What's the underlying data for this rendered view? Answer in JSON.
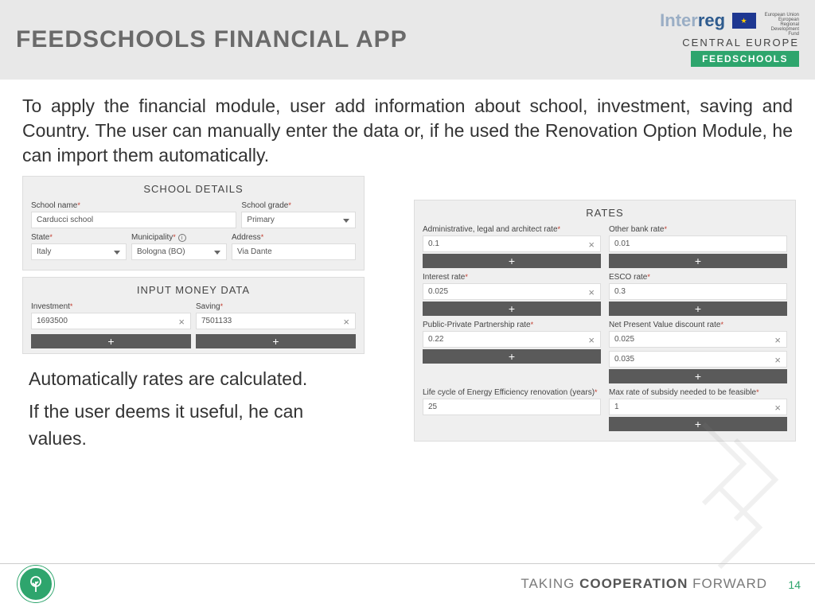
{
  "header": {
    "title": "FEEDSCHOOLS FINANCIAL APP",
    "logo_top": "Interreg",
    "logo_sub": "CENTRAL EUROPE",
    "logo_badge": "FEEDSCHOOLS",
    "eu_text": "European Union European Regional Development Fund"
  },
  "intro": "To apply the financial module, user add information about school, investment, saving and Country. The user can manually enter the data or, if he used the Renovation Option Module, he can import them automatically.",
  "school": {
    "panel_title": "SCHOOL DETAILS",
    "name_lbl": "School name",
    "name_val": "Carducci school",
    "grade_lbl": "School grade",
    "grade_val": "Primary",
    "state_lbl": "State",
    "state_val": "Italy",
    "muni_lbl": "Municipality",
    "muni_val": "Bologna (BO)",
    "addr_lbl": "Address",
    "addr_val": "Via Dante"
  },
  "money": {
    "panel_title": "INPUT MONEY DATA",
    "inv_lbl": "Investment",
    "inv_val": "1693500",
    "sav_lbl": "Saving",
    "sav_val": "7501133"
  },
  "rates": {
    "panel_title": "RATES",
    "admin_lbl": "Administrative, legal and architect rate",
    "admin_val": "0.1",
    "other_lbl": "Other bank rate",
    "other_val": "0.01",
    "int_lbl": "Interest rate",
    "int_val": "0.025",
    "esco_lbl": "ESCO rate",
    "esco_val": "0.3",
    "ppp_lbl": "Public-Private Partnership rate",
    "ppp_val": "0.22",
    "npv_lbl": "Net Present Value discount rate",
    "npv_val1": "0.025",
    "npv_val2": "0.035",
    "life_lbl": "Life cycle of Energy Efficiency renovation (years)",
    "life_val": "25",
    "max_lbl": "Max rate of subsidy needed to be feasible",
    "max_val": "1"
  },
  "body1": "Automatically rates are calculated.",
  "body2": "If the user deems it useful, he can",
  "body3": "values.",
  "footer": {
    "text_a": "TAKING ",
    "text_b": "COOPERATION",
    "text_c": " FORWARD",
    "page": "14"
  },
  "plus": "+"
}
